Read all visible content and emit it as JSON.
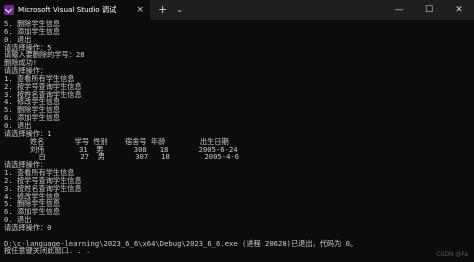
{
  "window": {
    "title": "Microsoft Visual Studio 调试",
    "tab_close": "×",
    "new_tab": "+",
    "dropdown": "⌄",
    "controls": {
      "minimize": "—",
      "maximize": "☐",
      "close": "✕"
    }
  },
  "terminal": {
    "lines": [
      "5. 删除学生信息",
      "6. 添加学生信息",
      "0. 退出",
      "请选择操作：5",
      "请输入要删除的学号：28",
      "删除成功!",
      "请选择操作：",
      "1. 查看所有学生信息",
      "2. 按学号查询学生信息",
      "3. 按姓名查询学生信息",
      "4. 修改学生信息",
      "5. 删除学生信息",
      "6. 添加学生信息",
      "0. 退出",
      "请选择操作：1",
      "      姓名       学号 性别    宿舍号 年龄        出生日期",
      "      刘伟        31  男       308   18       2005-6-24",
      "        白        27  男       307   18        2005-4-6",
      "请选择操作：",
      "1. 查看所有学生信息",
      "2. 按学号查询学生信息",
      "3. 按姓名查询学生信息",
      "4. 修改学生信息",
      "5. 删除学生信息",
      "6. 添加学生信息",
      "0. 退出",
      "请选择操作：0",
      "",
      "D:\\c-language-learning\\2023_6_6\\x64\\Debug\\2023_6_6.exe (进程 20628)已退出，代码为 0。",
      "按任意键关闭此窗口. . ."
    ]
  },
  "watermark": "CSDN @Fa"
}
